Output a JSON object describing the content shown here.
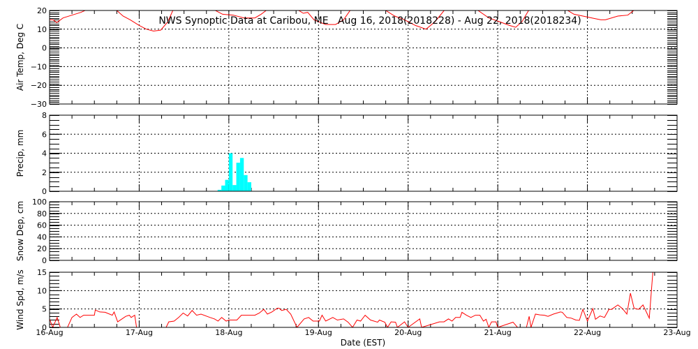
{
  "chart_data": [
    {
      "type": "line",
      "title": "NWS Synoptic Data at Caribou, ME   Aug 16, 2018(2018228) - Aug 22, 2018(2018234)",
      "ylabel": "Air Temp, Deg C",
      "ylim": [
        -30,
        20
      ],
      "yticks": [
        "20",
        "10",
        "0",
        "−10",
        "−20",
        "−30"
      ],
      "ytick_values": [
        20,
        10,
        0,
        -10,
        -20,
        -30
      ],
      "minor_step": 1,
      "color": "#ff0000",
      "segments": [
        {
          "x": [
            0,
            0.04,
            0.08,
            0.15,
            0.25,
            0.35,
            0.42
          ],
          "y": [
            15,
            15,
            13.5,
            16,
            17.5,
            19,
            20.5
          ]
        },
        {
          "x": [
            0.75,
            0.82,
            0.9,
            1.0,
            1.08,
            1.16,
            1.24,
            1.32,
            1.38
          ],
          "y": [
            20,
            17,
            15,
            12,
            10,
            9,
            9.5,
            14,
            20.5
          ]
        },
        {
          "x": [
            1.85,
            1.93,
            2.05,
            2.17,
            2.29,
            2.36,
            2.43
          ],
          "y": [
            20,
            18,
            17.5,
            16,
            16,
            18,
            20.5
          ]
        },
        {
          "x": [
            2.78,
            2.83,
            2.88,
            2.95,
            3.08,
            3.19,
            3.28,
            3.36
          ],
          "y": [
            20,
            18.5,
            19,
            15,
            12.5,
            12.5,
            15,
            20.5
          ]
        },
        {
          "x": [
            3.75,
            3.85,
            3.96,
            4.08,
            4.2,
            4.3,
            4.41
          ],
          "y": [
            20,
            17,
            15,
            12,
            10,
            14,
            20.5
          ]
        },
        {
          "x": [
            4.78,
            4.9,
            5.02,
            5.13,
            5.2,
            5.27,
            5.35
          ],
          "y": [
            20,
            16,
            14,
            12,
            11,
            14,
            20.5
          ]
        },
        {
          "x": [
            5.78,
            5.85,
            5.95,
            6.05,
            6.15,
            6.2,
            6.34,
            6.45,
            6.53
          ],
          "y": [
            20,
            18,
            17,
            16,
            15,
            15,
            17,
            17.5,
            20.5
          ]
        }
      ]
    },
    {
      "type": "bar",
      "ylabel": "Precip, mm",
      "ylim": [
        0,
        8
      ],
      "yticks": [
        "8",
        "6",
        "4",
        "2",
        "0"
      ],
      "ytick_values": [
        8,
        6,
        4,
        2,
        0
      ],
      "minor_step": 0.5,
      "color": "#00ffff",
      "bar_hours": [
        45,
        46,
        47,
        48,
        49,
        50,
        51,
        52,
        53
      ],
      "values": [
        0.15,
        0.6,
        1.2,
        4.0,
        0.65,
        3.0,
        3.5,
        1.7,
        0.95
      ]
    },
    {
      "type": "line",
      "ylabel": "Snow Dep, cm",
      "ylim": [
        0,
        100
      ],
      "yticks": [
        "100",
        "80",
        "60",
        "40",
        "20",
        "0"
      ],
      "ytick_values": [
        100,
        80,
        60,
        40,
        20,
        0
      ],
      "minor_step": 5,
      "segments": []
    },
    {
      "type": "line",
      "ylabel": "Wind Spd, m/s",
      "ylim": [
        0,
        15
      ],
      "yticks": [
        "15",
        "10",
        "5",
        "0"
      ],
      "ytick_values": [
        15,
        10,
        5,
        0
      ],
      "minor_step": 1,
      "color": "#ff0000",
      "segments": [
        {
          "x": [
            0,
            0.035,
            0.085,
            0.12,
            0.2,
            0.25,
            0.3,
            0.34,
            0.38,
            0.5,
            0.51,
            0.56,
            0.62,
            0.7,
            0.72,
            0.76,
            0.85,
            0.89,
            0.91,
            0.95,
            0.97,
            1.3,
            1.33,
            1.39,
            1.44,
            1.49,
            1.54,
            1.59,
            1.64,
            1.69,
            1.79,
            1.84,
            1.88,
            1.92,
            1.97,
            2.0,
            2.09,
            2.14,
            2.29,
            2.34,
            2.39,
            2.43,
            2.48,
            2.54,
            2.56,
            2.59,
            2.64,
            2.69,
            2.76,
            2.84,
            2.89,
            2.94,
            3.01,
            3.04,
            3.08,
            3.16,
            3.21,
            3.28,
            3.33,
            3.38,
            3.43,
            3.47,
            3.52,
            3.58,
            3.66,
            3.68,
            3.74,
            3.77,
            3.81,
            3.86,
            3.88,
            3.96,
            4.0,
            4.13,
            4.15,
            4.35,
            4.4,
            4.45,
            4.49,
            4.53,
            4.58,
            4.6,
            4.65,
            4.7,
            4.75,
            4.8,
            4.84,
            4.87,
            4.9,
            4.93,
            4.98,
            5.0,
            5.17,
            5.22,
            5.32,
            5.35,
            5.37,
            5.42,
            5.47,
            5.52,
            5.56,
            5.62,
            5.7,
            5.72,
            5.77,
            5.82,
            5.87,
            5.91,
            5.95,
            6.0,
            6.06,
            6.09,
            6.14,
            6.19,
            6.24,
            6.27,
            6.34,
            6.39,
            6.44,
            6.48,
            6.52,
            6.57,
            6.62,
            6.69,
            6.73
          ],
          "y": [
            2.3,
            0,
            2.7,
            0,
            0,
            2.7,
            3.6,
            2.7,
            3.3,
            3.3,
            4.7,
            4.2,
            4.1,
            3.3,
            4.2,
            1.5,
            3.0,
            3.3,
            2.7,
            3.3,
            0,
            0,
            1.5,
            1.7,
            2.7,
            3.9,
            3.1,
            4.6,
            3.3,
            3.6,
            2.7,
            2.3,
            1.7,
            2.7,
            1.7,
            2.0,
            2.0,
            3.3,
            3.3,
            3.9,
            4.9,
            3.6,
            4.2,
            5.2,
            5.2,
            4.6,
            4.9,
            3.6,
            0,
            2.3,
            2.7,
            1.7,
            1.7,
            3.3,
            1.7,
            2.7,
            2.0,
            2.3,
            1.4,
            0,
            2.0,
            1.7,
            3.3,
            2.0,
            1.4,
            2.0,
            1.4,
            0,
            1.5,
            1.4,
            0,
            1.5,
            0,
            2.3,
            0,
            1.5,
            1.5,
            2.3,
            1.7,
            2.7,
            2.7,
            4.1,
            3.3,
            2.7,
            3.3,
            3.3,
            1.7,
            2.2,
            0,
            1.5,
            1.5,
            0,
            1.4,
            0,
            0,
            3.0,
            0,
            3.6,
            3.4,
            3.3,
            3.0,
            3.6,
            4.2,
            4.1,
            2.7,
            2.5,
            2.0,
            1.9,
            4.9,
            1.7,
            5.1,
            2.2,
            3.1,
            2.7,
            4.9,
            4.9,
            6.1,
            5.1,
            3.6,
            9.3,
            5.2,
            4.9,
            6.1,
            2.5,
            15
          ]
        }
      ]
    }
  ],
  "xaxis": {
    "xlabel": "Date (EST)",
    "xticks": [
      "16-Aug",
      "17-Aug",
      "18-Aug",
      "19-Aug",
      "20-Aug",
      "21-Aug",
      "22-Aug",
      "23-Aug"
    ],
    "xlim_days": [
      0,
      7
    ]
  }
}
